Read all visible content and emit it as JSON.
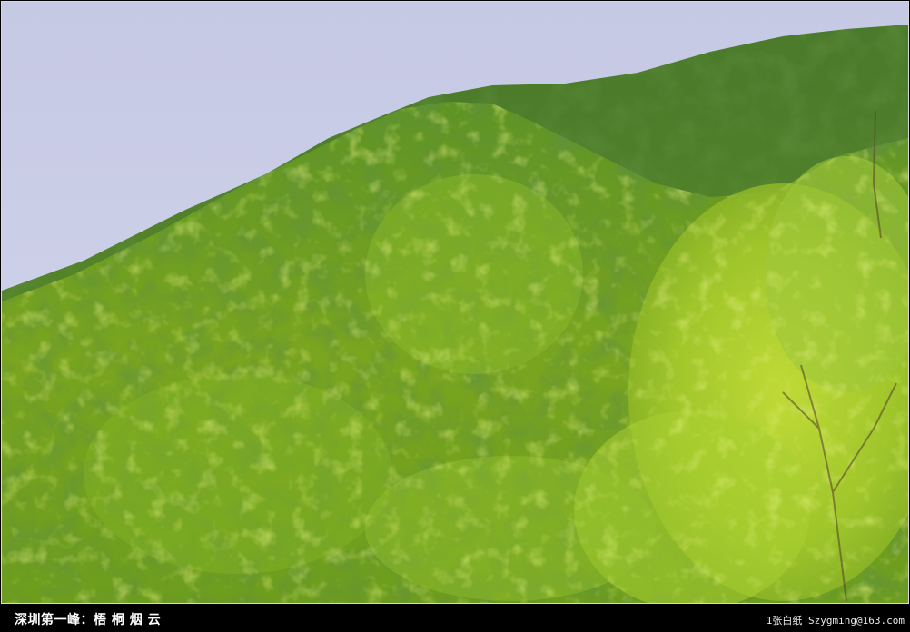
{
  "photo": {
    "subject": "forested-mountain-slope",
    "colors": {
      "sky": "#c9cde6",
      "far_ridge": "#4f7d2a",
      "mid_forest": "#6e9b22",
      "bright_foliage": "#b9d92f",
      "shadow_green": "#2f5e18"
    }
  },
  "caption": {
    "title": "深圳第一峰：梧 桐 烟 云",
    "credit": "1张白纸 Szygming@163.com"
  }
}
